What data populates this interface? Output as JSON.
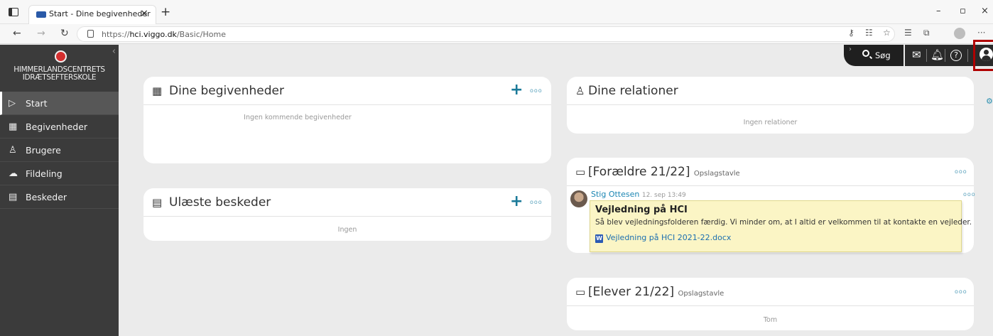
{
  "browser": {
    "tab_title": "Start - Dine begivenheder",
    "tab_close": "×",
    "new_tab": "+",
    "url_scheme": "https://",
    "url_host": "hci.viggo.dk",
    "url_path": "/Basic/Home",
    "win_minimize": "–",
    "win_restore": "▫",
    "win_close": "×",
    "more": "···"
  },
  "sidebar": {
    "school_line1": "HIMMERLANDSCENTRETS",
    "school_line2": "IDRÆTSEFTERSKOLE",
    "items": [
      {
        "label": "Start",
        "icon": "play-outline-icon",
        "glyph": "▷"
      },
      {
        "label": "Begivenheder",
        "icon": "calendar-icon",
        "glyph": "▦"
      },
      {
        "label": "Brugere",
        "icon": "users-icon",
        "glyph": "♙"
      },
      {
        "label": "Fildeling",
        "icon": "cloud-upload-icon",
        "glyph": "☁"
      },
      {
        "label": "Beskeder",
        "icon": "chat-icon",
        "glyph": "▤"
      }
    ]
  },
  "header": {
    "search_label": "Søg",
    "mail_glyph": "✉",
    "bell_glyph": "♫",
    "help_glyph": "?"
  },
  "cards": {
    "events": {
      "title": "Dine begivenheder",
      "empty": "Ingen kommende begivenheder",
      "plus": "+",
      "dots": "ooo"
    },
    "messages": {
      "title": "Ulæste beskeder",
      "empty": "Ingen",
      "plus": "+",
      "dots": "ooo"
    },
    "relations": {
      "title": "Dine relationer",
      "empty": "Ingen relationer"
    },
    "parents": {
      "title": "[Forældre 21/22]",
      "subtitle": "Opslagstavle",
      "dots": "ooo",
      "post": {
        "author": "Stig Ottesen",
        "date": "12. sep 13:49",
        "dots": "ooo",
        "title": "Vejledning på HCI",
        "body": "Så blev vejledningsfolderen færdig. Vi minder om, at I altid er velkommen til at kontakte en vejleder.",
        "attachment": "Vejledning på HCI 2021-22.docx"
      }
    },
    "students": {
      "title": "[Elever 21/22]",
      "subtitle": "Opslagstavle",
      "empty": "Tom",
      "dots": "ooo"
    }
  },
  "colors": {
    "accent": "#1b7a99",
    "sidebar_bg": "#3b3b3b",
    "header_dark": "#1f1f1f",
    "highlight_border": "#b00000",
    "note_bg": "#fbf5c5"
  }
}
